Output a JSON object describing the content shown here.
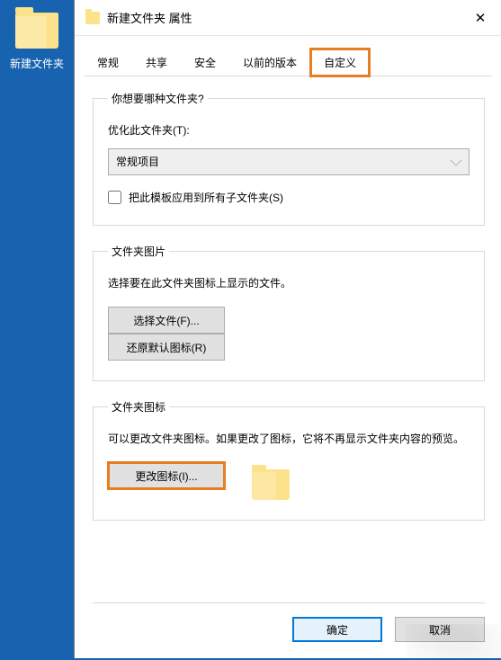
{
  "desktop": {
    "folder_label": "新建文件夹"
  },
  "dialog": {
    "title": "新建文件夹 属性"
  },
  "tabs": {
    "general": "常规",
    "sharing": "共享",
    "security": "安全",
    "previous": "以前的版本",
    "customize": "自定义"
  },
  "section_type": {
    "legend": "你想要哪种文件夹?",
    "optimize_label": "优化此文件夹(T):",
    "dropdown_value": "常规项目",
    "apply_checkbox": "把此模板应用到所有子文件夹(S)"
  },
  "section_picture": {
    "legend": "文件夹图片",
    "desc": "选择要在此文件夹图标上显示的文件。",
    "choose_file_btn": "选择文件(F)...",
    "restore_default_btn": "还原默认图标(R)"
  },
  "section_icon": {
    "legend": "文件夹图标",
    "desc": "可以更改文件夹图标。如果更改了图标，它将不再显示文件夹内容的预览。",
    "change_icon_btn": "更改图标(I)..."
  },
  "footer": {
    "ok": "确定",
    "cancel": "取消"
  }
}
